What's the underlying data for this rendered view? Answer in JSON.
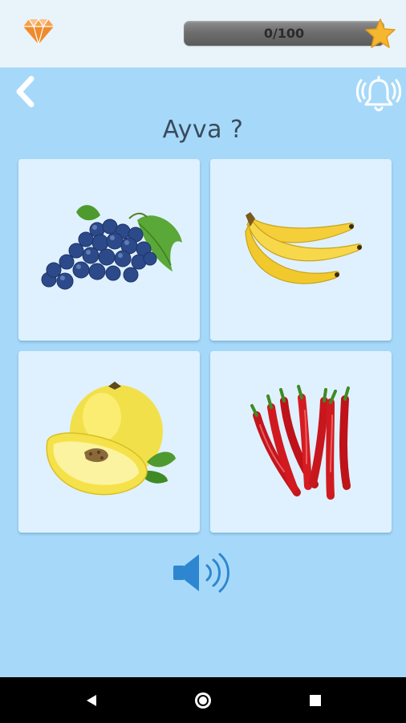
{
  "header": {
    "gem_icon": "diamond-icon",
    "progress": {
      "text": "0/100",
      "value": 0,
      "max": 100
    },
    "star_icon": "star-icon"
  },
  "toolbar": {
    "back_icon": "chevron-left-icon",
    "bell_icon": "ringing-bell-icon"
  },
  "question": {
    "text": "Ayva ?"
  },
  "options": [
    {
      "name": "grapes",
      "image": "grapes-image"
    },
    {
      "name": "bananas",
      "image": "bananas-image"
    },
    {
      "name": "quince",
      "image": "quince-image"
    },
    {
      "name": "chili-peppers",
      "image": "chili-peppers-image"
    }
  ],
  "audio": {
    "icon": "speaker-icon"
  },
  "system_nav": {
    "back": "back-triangle-icon",
    "home": "home-circle-icon",
    "recents": "recents-square-icon"
  },
  "colors": {
    "background": "#a6d9f9",
    "header": "#e9f3fa",
    "card": "#dff1fe",
    "accent_orange": "#f4a13a",
    "star": "#f4b432",
    "speaker": "#2f86d0"
  }
}
